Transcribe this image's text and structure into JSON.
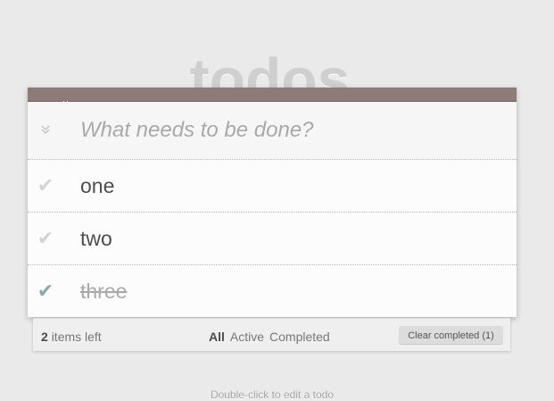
{
  "app": {
    "title": "todos"
  },
  "new_todo": {
    "placeholder": "What needs to be done?",
    "value": ""
  },
  "icons": {
    "toggle_all": "double-chevron-down-icon",
    "check": "checkmark-icon"
  },
  "todos": [
    {
      "label": "one",
      "completed": false
    },
    {
      "label": "two",
      "completed": false
    },
    {
      "label": "three",
      "completed": true
    }
  ],
  "footer": {
    "count": "2",
    "count_suffix": "items left",
    "filters": [
      "All",
      "Active",
      "Completed"
    ],
    "selected_filter": "All",
    "clear_label": "Clear completed (1)"
  },
  "info": {
    "text": "Double-click to edit a todo"
  },
  "colors": {
    "header_bar": "#8c7c75",
    "check_done": "#85ada7",
    "check_undone": "#d3d3d3",
    "title": "#cfcfcf"
  }
}
